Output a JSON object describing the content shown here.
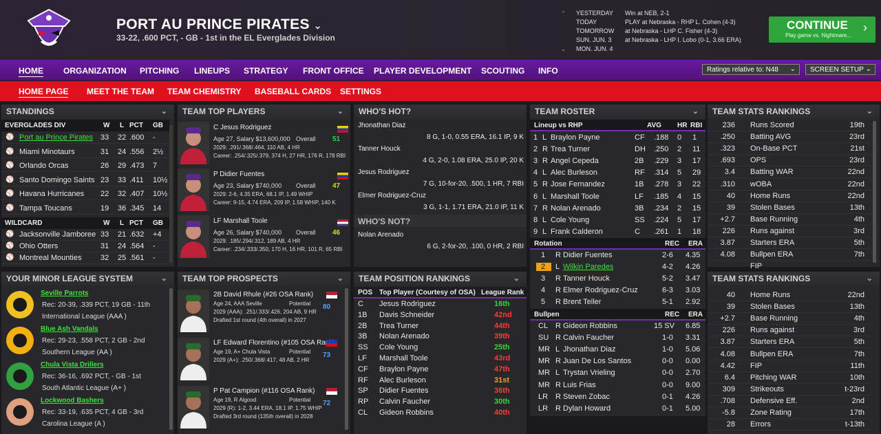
{
  "header": {
    "team": "PORT AU PRINCE PIRATES",
    "record": "33-22, .600 PCT, - GB - 1st in the EL Everglades Division",
    "schedule": [
      [
        "YESTERDAY",
        "Win at NEB, 2-1"
      ],
      [
        "TODAY",
        "PLAY at Nebraska - RHP L. Cohen (4-3)"
      ],
      [
        "TOMORROW",
        "at Nebraska - LHP C. Fisher (4-3)"
      ],
      [
        "SUN. JUN. 3",
        "at Nebraska - LHP I. Lobo (0-1, 3.66 ERA)"
      ],
      [
        "MON. JUN. 4",
        ""
      ]
    ],
    "continue_label": "CONTINUE",
    "continue_sub": "Play game vs. Nightmare..."
  },
  "nav": [
    "HOME",
    "ORGANIZATION",
    "PITCHING",
    "LINEUPS",
    "STRATEGY",
    "FRONT OFFICE",
    "PLAYER DEVELOPMENT",
    "SCOUTING",
    "INFO"
  ],
  "ratings_dropdown": "Ratings relative to: N48",
  "screen_setup": "SCREEN SETUP",
  "subnav": [
    "HOME PAGE",
    "MEET THE TEAM",
    "TEAM CHEMISTRY",
    "BASEBALL CARDS",
    "SETTINGS"
  ],
  "standings": {
    "title": "STANDINGS",
    "div": "EVERGLADES DIV",
    "cols": [
      "W",
      "L",
      "PCT",
      "GB"
    ],
    "rows": [
      [
        "Port au Prince Pirates",
        "33",
        "22",
        ".600",
        "-"
      ],
      [
        "Miami Minotaurs",
        "31",
        "24",
        ".556",
        "2½"
      ],
      [
        "Orlando Orcas",
        "26",
        "29",
        ".473",
        "7"
      ],
      [
        "Santo Domingo Saints",
        "23",
        "33",
        ".411",
        "10½"
      ],
      [
        "Havana Hurricanes",
        "22",
        "32",
        ".407",
        "10½"
      ],
      [
        "Tampa Toucans",
        "19",
        "36",
        ".345",
        "14"
      ]
    ],
    "wildcard": "WILDCARD",
    "wc": [
      [
        "Jacksonville Jamboree",
        "33",
        "21",
        ".632",
        "+4"
      ],
      [
        "Ohio Otters",
        "31",
        "24",
        ".564",
        "-"
      ],
      [
        "Montreal Mounties",
        "32",
        "25",
        ".561",
        "-"
      ]
    ]
  },
  "top_players": {
    "title": "TEAM TOP PLAYERS",
    "players": [
      {
        "name": "C Jesus Rodriguez",
        "info": "Age 27, Salary $13,600,000",
        "ovr": "51",
        "l1": "2029: .291/.368/.464, 110 AB, 4 HR",
        "l2": "Career: .254/.325/.379, 374 H, 27 HR, 176 R, 178 RBI"
      },
      {
        "name": "P Didier Fuentes",
        "info": "Age 23, Salary $740,000",
        "ovr": "47",
        "l1": "2029: 2-6, 4.35 ERA, 68.1 IP, 1.49 WHIP",
        "l2": "Career: 9-15, 4.74 ERA, 209 IP, 1.58 WHIP, 140 K"
      },
      {
        "name": "LF Marshall Toole",
        "info": "Age 26, Salary $740,000",
        "ovr": "46",
        "l1": "2029: .185/.294/.312, 189 AB, 4 HR",
        "l2": "Career: .234/.333/.350, 170 H, 16 HR, 101 R, 65 RBI"
      }
    ],
    "overall": "Overall"
  },
  "whos_hot": {
    "title": "WHO'S HOT?",
    "rows": [
      [
        "Jhonathan Diaz",
        "8 G, 1-0, 0.55 ERA, 16.1 IP, 9 K"
      ],
      [
        "Tanner Houck",
        "4 G, 2-0, 1.08 ERA, 25.0 IP, 20 K"
      ],
      [
        "Jesus Rodriguez",
        "7 G, 10-for-20, .500, 1 HR, 7 RBI"
      ],
      [
        "Elmer Rodriguez-Cruz",
        "3 G, 1-1, 1.71 ERA, 21.0 IP, 11 K"
      ]
    ],
    "not_title": "WHO'S NOT?",
    "not": [
      [
        "Nolan Arenado",
        "6 G, 2-for-20, .100, 0 HR, 2 RBI"
      ]
    ]
  },
  "roster": {
    "title": "TEAM ROSTER",
    "lineup_hdr": "Lineup vs RHP",
    "cols": [
      "AVG",
      "HR",
      "RBI"
    ],
    "lineup": [
      [
        "1",
        "L",
        "Braylon Payne",
        "CF",
        ".188",
        "0",
        "1"
      ],
      [
        "2",
        "R",
        "Trea Turner",
        "DH",
        ".250",
        "2",
        "11"
      ],
      [
        "3",
        "R",
        "Angel Cepeda",
        "2B",
        ".229",
        "3",
        "17"
      ],
      [
        "4",
        "L",
        "Alec Burleson",
        "RF",
        ".314",
        "5",
        "29"
      ],
      [
        "5",
        "R",
        "Jose Fernandez",
        "1B",
        ".278",
        "3",
        "22"
      ],
      [
        "6",
        "L",
        "Marshall Toole",
        "LF",
        ".185",
        "4",
        "15"
      ],
      [
        "7",
        "R",
        "Nolan Arenado",
        "3B",
        ".234",
        "2",
        "15"
      ],
      [
        "8",
        "L",
        "Cole Young",
        "SS",
        ".224",
        "5",
        "17"
      ],
      [
        "9",
        "L",
        "Frank Calderon",
        "C",
        ".261",
        "1",
        "18"
      ]
    ],
    "rot_hdr": "Rotation",
    "rot_cols": [
      "REC",
      "ERA"
    ],
    "rotation": [
      [
        "1",
        "R",
        "Didier Fuentes",
        "2-6",
        "4.35"
      ],
      [
        "2",
        "L",
        "Wilkin Paredes",
        "4-2",
        "4.26"
      ],
      [
        "3",
        "R",
        "Tanner Houck",
        "5-2",
        "3.47"
      ],
      [
        "4",
        "R",
        "Elmer Rodriguez-Cruz",
        "6-3",
        "3.03"
      ],
      [
        "5",
        "R",
        "Brent Teller",
        "5-1",
        "2.92"
      ]
    ],
    "pen_hdr": "Bullpen",
    "bullpen": [
      [
        "CL",
        "R",
        "Gideon Robbins",
        "15 SV",
        "6.85"
      ],
      [
        "SU",
        "R",
        "Calvin Faucher",
        "1-0",
        "3.31"
      ],
      [
        "MR",
        "L",
        "Jhonathan Diaz",
        "1-0",
        "5.06"
      ],
      [
        "MR",
        "R",
        "Juan De Los Santos",
        "0-0",
        "0.00"
      ],
      [
        "MR",
        "L",
        "Trystan Vrieling",
        "0-0",
        "2.70"
      ],
      [
        "MR",
        "R",
        "Luis Frias",
        "0-0",
        "9.00"
      ],
      [
        "LR",
        "R",
        "Steven Zobac",
        "0-1",
        "4.26"
      ],
      [
        "LR",
        "R",
        "Dylan Howard",
        "0-1",
        "5.00"
      ]
    ]
  },
  "stats1": {
    "title": "TEAM STATS RANKINGS",
    "rows": [
      [
        "236",
        "Runs Scored",
        "19th"
      ],
      [
        ".250",
        "Batting AVG",
        "23rd"
      ],
      [
        ".323",
        "On-Base PCT",
        "21st"
      ],
      [
        ".693",
        "OPS",
        "23rd"
      ],
      [
        "3.4",
        "Batting WAR",
        "22nd"
      ],
      [
        ".310",
        "wOBA",
        "22nd"
      ],
      [
        "40",
        "Home Runs",
        "22nd"
      ],
      [
        "39",
        "Stolen Bases",
        "13th"
      ],
      [
        "+2.7",
        "Base Running",
        "4th"
      ],
      [
        "226",
        "Runs against",
        "3rd"
      ],
      [
        "3.87",
        "Starters ERA",
        "5th"
      ],
      [
        "4.08",
        "Bullpen ERA",
        "7th"
      ],
      [
        "",
        "FIP",
        ""
      ]
    ]
  },
  "minor": {
    "title": "YOUR MINOR LEAGUE SYSTEM",
    "teams": [
      {
        "name": "Seville Parrots",
        "l1": "Rec: 20-39, .339 PCT, 19 GB - 11th",
        "l2": "International League (AAA )"
      },
      {
        "name": "Blue Ash Vandals",
        "l1": "Rec: 29-23, .558 PCT, 2 GB - 2nd",
        "l2": "Southern League (AA )"
      },
      {
        "name": "Chula Vista Drillers",
        "l1": "Rec: 36-16, .692 PCT, - GB - 1st",
        "l2": "South Atlantic League (A+ )"
      },
      {
        "name": "Lockwood Bashers",
        "l1": "Rec: 33-19, .635 PCT, 4 GB - 3rd",
        "l2": "Carolina League (A )"
      }
    ]
  },
  "prospects": {
    "title": "TEAM TOP PROSPECTS",
    "potential": "Potential",
    "players": [
      {
        "name": "2B David Rhule (#26 OSA Rank)",
        "info": "Age 24, AAA Seville",
        "pot": "80",
        "l1": "2029 (AAA): .251/.333/.426, 204 AB, 9 HR",
        "l2": "Drafted 1st round (4th overall) in 2027"
      },
      {
        "name": "LF Edward Florentino (#105 OSA Rank)",
        "info": "Age 19, A+ Chula Vista",
        "pot": "73",
        "l1": "2029 (A+): .250/.368/.417, 48 AB, 2 HR",
        "l2": ""
      },
      {
        "name": "P Pat Campion (#116 OSA Rank)",
        "info": "Age 19, R Algood",
        "pot": "72",
        "l1": "2029 (R): 1-2, 3.44 ERA, 18.1 IP, 1.75 WHIP",
        "l2": "Drafted 3rd round (135th overall) in 2028"
      }
    ]
  },
  "position": {
    "title": "TEAM POSITION RANKINGS",
    "cols": [
      "POS",
      "Top Player (Courtesy of OSA)",
      "League Rank"
    ],
    "rows": [
      [
        "C",
        "Jesus Rodriguez",
        "16th"
      ],
      [
        "1B",
        "Davis Schneider",
        "42nd"
      ],
      [
        "2B",
        "Trea Turner",
        "44th"
      ],
      [
        "3B",
        "Nolan Arenado",
        "39th"
      ],
      [
        "SS",
        "Cole Young",
        "25th"
      ],
      [
        "LF",
        "Marshall Toole",
        "43rd"
      ],
      [
        "CF",
        "Braylon Payne",
        "47th"
      ],
      [
        "RF",
        "Alec Burleson",
        "31st"
      ],
      [
        "SP",
        "Didier Fuentes",
        "36th"
      ],
      [
        "RP",
        "Calvin Faucher",
        "30th"
      ],
      [
        "CL",
        "Gideon Robbins",
        "40th"
      ]
    ]
  },
  "stats2": {
    "title": "TEAM STATS RANKINGS",
    "rows": [
      [
        "40",
        "Home Runs",
        "22nd"
      ],
      [
        "39",
        "Stolen Bases",
        "13th"
      ],
      [
        "+2.7",
        "Base Running",
        "4th"
      ],
      [
        "226",
        "Runs against",
        "3rd"
      ],
      [
        "3.87",
        "Starters ERA",
        "5th"
      ],
      [
        "4.08",
        "Bullpen ERA",
        "7th"
      ],
      [
        "4.42",
        "FIP",
        "11th"
      ],
      [
        "6.4",
        "Pitching WAR",
        "10th"
      ],
      [
        "309",
        "Strikeouts",
        "t-23rd"
      ],
      [
        ".708",
        "Defensive Eff.",
        "2nd"
      ],
      [
        "-5.8",
        "Zone Rating",
        "17th"
      ],
      [
        "28",
        "Errors",
        "t-13th"
      ]
    ]
  }
}
